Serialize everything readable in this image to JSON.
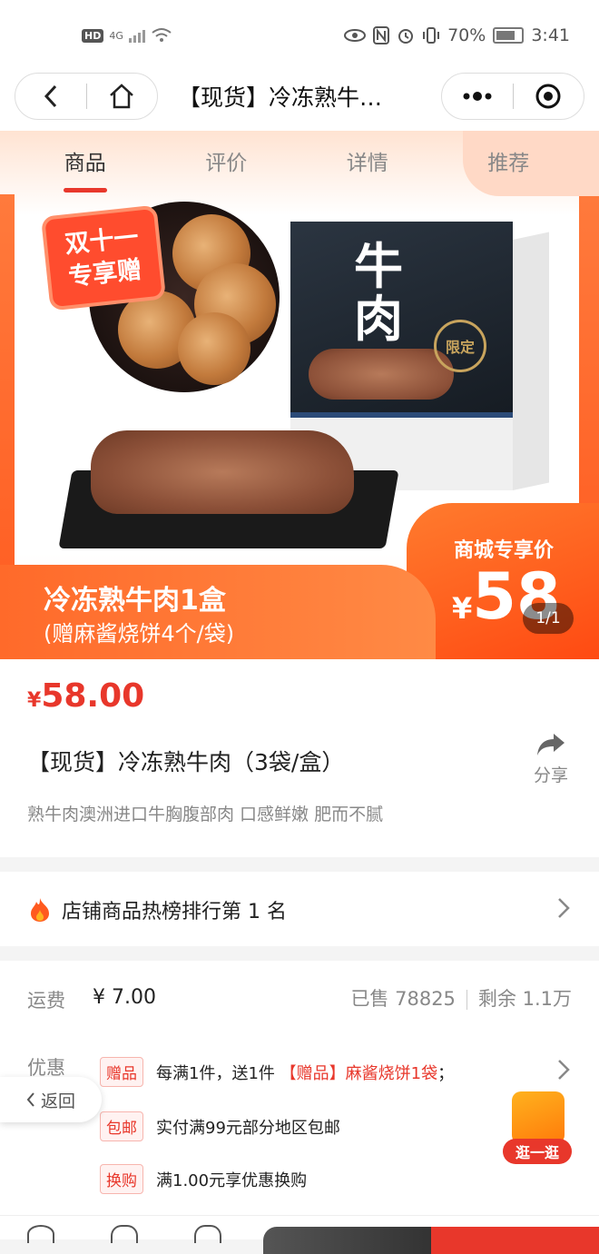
{
  "status_bar": {
    "left_badge": "HD",
    "network": "4G",
    "battery": "70%",
    "time": "3:41"
  },
  "top_bar": {
    "title": "【现货】冷冻熟牛…"
  },
  "hero": {
    "tabs": [
      "商品",
      "评价",
      "详情",
      "推荐"
    ],
    "active_tab": 0,
    "gift_badge_line1": "双十一",
    "gift_badge_line2": "专享赠",
    "box_char": "牛肉",
    "box_stamp": "限定",
    "promo_title": "冷冻熟牛肉1盒",
    "promo_sub": "(赠麻酱烧饼4个/袋)",
    "price_tag_label": "商城专享价",
    "price_tag_currency": "¥",
    "price_tag_value": "58",
    "page_indicator": "1/1"
  },
  "product": {
    "price_currency": "¥",
    "price": "58.00",
    "title": "【现货】冷冻熟牛肉（3袋/盒）",
    "share_label": "分享",
    "description": "熟牛肉澳洲进口牛胸腹部肉 口感鲜嫩 肥而不腻"
  },
  "ranking": {
    "text": "店铺商品热榜排行第 1 名"
  },
  "details": {
    "shipping_label": "运费",
    "shipping_value": "¥ 7.00",
    "sold": "已售 78825",
    "remaining": "剩余 1.1万",
    "promo_label": "优惠",
    "promos": [
      {
        "tag": "赠品",
        "text": "每满1件，送1件 ",
        "highlight": "【赠品】麻酱烧饼1袋",
        "suffix": "；"
      },
      {
        "tag": "包邮",
        "text": "实付满99元部分地区包邮",
        "highlight": "",
        "suffix": ""
      },
      {
        "tag": "换购",
        "text": "满1.00元享优惠换购",
        "highlight": "",
        "suffix": ""
      }
    ]
  },
  "floating": {
    "back_label": "返回",
    "shop_label": "逛一逛"
  },
  "colors": {
    "accent": "#e8372b",
    "orange": "#ff6a2a"
  }
}
